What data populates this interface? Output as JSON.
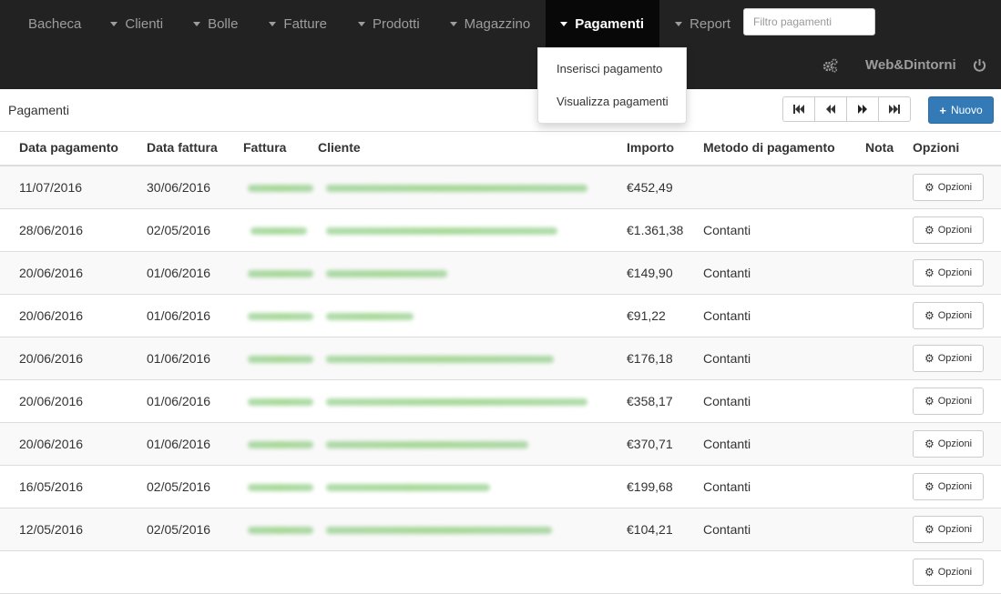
{
  "nav": {
    "items": [
      {
        "label": "Bacheca",
        "caret": false,
        "active": false
      },
      {
        "label": "Clienti",
        "caret": true,
        "active": false
      },
      {
        "label": "Bolle",
        "caret": true,
        "active": false
      },
      {
        "label": "Fatture",
        "caret": true,
        "active": false
      },
      {
        "label": "Prodotti",
        "caret": true,
        "active": false
      },
      {
        "label": "Magazzino",
        "caret": true,
        "active": false
      },
      {
        "label": "Pagamenti",
        "caret": true,
        "active": true
      },
      {
        "label": "Report",
        "caret": true,
        "active": false
      }
    ],
    "filter_placeholder": "Filtro pagamenti",
    "brand": "Web&Dintorni",
    "settings_icon": "gears-icon",
    "logout_icon": "power-icon"
  },
  "dropdown": {
    "items": [
      "Inserisci pagamento",
      "Visualizza pagamenti"
    ]
  },
  "panel": {
    "title": "Pagamenti",
    "new_label": "Nuovo",
    "pager_icons": [
      "first-page-icon",
      "previous-page-icon",
      "next-page-icon",
      "last-page-icon"
    ]
  },
  "table": {
    "headers": [
      "Data pagamento",
      "Data fattura",
      "Fattura",
      "Cliente",
      "Importo",
      "Metodo di pagamento",
      "Nota",
      "Opzioni"
    ],
    "option_label": "Opzioni",
    "rows": [
      {
        "data_pagamento": "11/07/2016",
        "data_fattura": "30/06/2016",
        "importo": "€452,49",
        "metodo": "",
        "nota": ""
      },
      {
        "data_pagamento": "28/06/2016",
        "data_fattura": "02/05/2016",
        "importo": "€1.361,38",
        "metodo": "Contanti",
        "nota": ""
      },
      {
        "data_pagamento": "20/06/2016",
        "data_fattura": "01/06/2016",
        "importo": "€149,90",
        "metodo": "Contanti",
        "nota": ""
      },
      {
        "data_pagamento": "20/06/2016",
        "data_fattura": "01/06/2016",
        "importo": "€91,22",
        "metodo": "Contanti",
        "nota": ""
      },
      {
        "data_pagamento": "20/06/2016",
        "data_fattura": "01/06/2016",
        "importo": "€176,18",
        "metodo": "Contanti",
        "nota": ""
      },
      {
        "data_pagamento": "20/06/2016",
        "data_fattura": "01/06/2016",
        "importo": "€358,17",
        "metodo": "Contanti",
        "nota": ""
      },
      {
        "data_pagamento": "20/06/2016",
        "data_fattura": "01/06/2016",
        "importo": "€370,71",
        "metodo": "Contanti",
        "nota": ""
      },
      {
        "data_pagamento": "16/05/2016",
        "data_fattura": "02/05/2016",
        "importo": "€199,68",
        "metodo": "Contanti",
        "nota": ""
      },
      {
        "data_pagamento": "12/05/2016",
        "data_fattura": "02/05/2016",
        "importo": "€104,21",
        "metodo": "Contanti",
        "nota": ""
      },
      {
        "data_pagamento": "",
        "data_fattura": "",
        "importo": "",
        "metodo": "",
        "nota": ""
      }
    ]
  },
  "colors": {
    "navbar": "#222222",
    "navbar_active": "#080808",
    "primary": "#337ab7"
  }
}
